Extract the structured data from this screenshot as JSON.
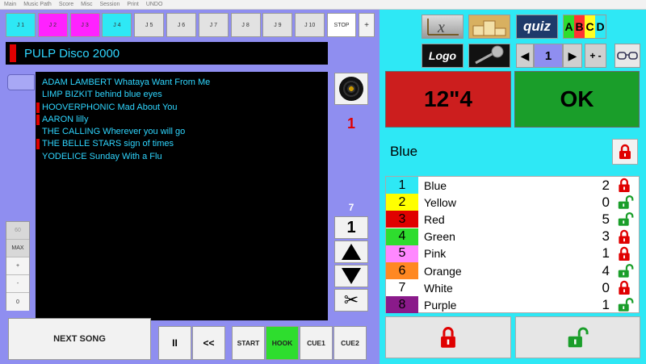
{
  "menu": [
    "Main",
    "Music Path",
    "Score",
    "Misc",
    "Session",
    "Print",
    "UNDO"
  ],
  "jingles": [
    {
      "label": "J 1",
      "color": "#2ee8f5"
    },
    {
      "label": "J 2",
      "color": "#ff22ff"
    },
    {
      "label": "J 3",
      "color": "#ff22ff"
    },
    {
      "label": "J 4",
      "color": "#2ee8f5"
    },
    {
      "label": "J 5",
      "color": "#e2e2e2"
    },
    {
      "label": "J 6",
      "color": "#e2e2e2"
    },
    {
      "label": "J 7",
      "color": "#e2e2e2"
    },
    {
      "label": "J 8",
      "color": "#e2e2e2"
    },
    {
      "label": "J 9",
      "color": "#e2e2e2"
    },
    {
      "label": "J 10",
      "color": "#e2e2e2"
    }
  ],
  "stop_label": "STOP",
  "plus_label": "+",
  "playlist_title": "PULP Disco 2000",
  "songs": [
    {
      "text": "ADAM LAMBERT Whataya Want From Me",
      "flag": false
    },
    {
      "text": "LIMP BIZKIT behind blue eyes",
      "flag": false
    },
    {
      "text": "HOOVERPHONIC Mad About You",
      "flag": true
    },
    {
      "text": "AARON lilly",
      "flag": true
    },
    {
      "text": "THE CALLING Wherever you will go",
      "flag": false
    },
    {
      "text": "THE BELLE STARS sign of times",
      "flag": true
    },
    {
      "text": "YODELICE Sunday With a Flu",
      "flag": false
    }
  ],
  "red_count": "1",
  "step_top": "7",
  "step_value": "1",
  "volume": {
    "value": "60",
    "max": "MAX",
    "plus": "+",
    "minus": "-",
    "min": "0"
  },
  "next_song": "NEXT SONG",
  "pause": "II",
  "rewind": "<<",
  "cues": [
    {
      "label": "START",
      "active": false
    },
    {
      "label": "HOOK",
      "active": true
    },
    {
      "label": "CUE1",
      "active": false
    },
    {
      "label": "CUE2",
      "active": false
    }
  ],
  "quiz_label": "quiz",
  "abcd": [
    {
      "letter": "A",
      "bg": "#2edd2e"
    },
    {
      "letter": "B",
      "bg": "#ff3333"
    },
    {
      "letter": "C",
      "bg": "#ffff22"
    },
    {
      "letter": "D",
      "bg": "#2ee8f5"
    }
  ],
  "logo_label": "Logo",
  "page_num": "1",
  "plus_minus": "+ -",
  "time_display": "12\"4",
  "ok_display": "OK",
  "current_color": "Blue",
  "colors": [
    {
      "num": "1",
      "name": "Blue",
      "count": "2",
      "swatch": "#2ee8f5",
      "locked": true
    },
    {
      "num": "2",
      "name": "Yellow",
      "count": "0",
      "swatch": "#ffff00",
      "locked": false
    },
    {
      "num": "3",
      "name": "Red",
      "count": "5",
      "swatch": "#e00000",
      "locked": false
    },
    {
      "num": "4",
      "name": "Green",
      "count": "3",
      "swatch": "#2edd2e",
      "locked": true
    },
    {
      "num": "5",
      "name": "Pink",
      "count": "1",
      "swatch": "#ff88ff",
      "locked": true
    },
    {
      "num": "6",
      "name": "Orange",
      "count": "4",
      "swatch": "#ff8822",
      "locked": false
    },
    {
      "num": "7",
      "name": "White",
      "count": "0",
      "swatch": "#ffffff",
      "locked": true
    },
    {
      "num": "8",
      "name": "Purple",
      "count": "1",
      "swatch": "#8a1a8a",
      "locked": false
    }
  ],
  "accent_lock_red": "#e00000",
  "accent_unlock_green": "#1a9e2a"
}
